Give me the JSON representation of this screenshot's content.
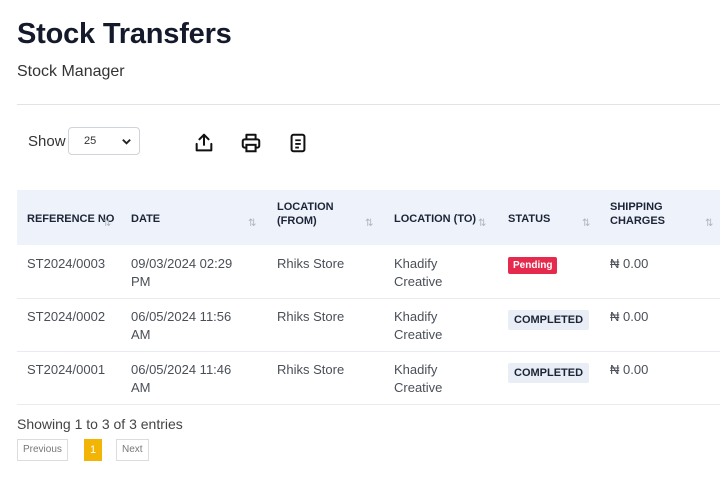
{
  "header": {
    "title": "Stock Transfers",
    "subtitle": "Stock Manager"
  },
  "controls": {
    "show_label": "Show",
    "page_length": "25",
    "icons": [
      "export-icon",
      "print-icon",
      "document-icon"
    ]
  },
  "table": {
    "columns": {
      "reference": "REFERENCE NO",
      "date": "DATE",
      "from_line1": "LOCATION",
      "from_line2": "(FROM)",
      "to": "LOCATION (TO)",
      "status": "STATUS",
      "shipping_line1": "SHIPPING",
      "shipping_line2": "CHARGES"
    },
    "rows": [
      {
        "reference": "ST2024/0003",
        "date_line1": "09/03/2024 02:29",
        "date_line2": "PM",
        "from": "Rhiks Store",
        "to_line1": "Khadify",
        "to_line2": "Creative",
        "status": "Pending",
        "shipping": "₦ 0.00"
      },
      {
        "reference": "ST2024/0002",
        "date_line1": "06/05/2024 11:56",
        "date_line2": "AM",
        "from": "Rhiks Store",
        "to_line1": "Khadify",
        "to_line2": "Creative",
        "status": "COMPLETED",
        "shipping": "₦ 0.00"
      },
      {
        "reference": "ST2024/0001",
        "date_line1": "06/05/2024 11:46",
        "date_line2": "AM",
        "from": "Rhiks Store",
        "to_line1": "Khadify",
        "to_line2": "Creative",
        "status": "COMPLETED",
        "shipping": "₦ 0.00"
      }
    ]
  },
  "footer": {
    "info": "Showing 1 to 3 of 3 entries",
    "previous": "Previous",
    "current_page": "1",
    "next": "Next"
  },
  "colors": {
    "pending": "#e52a4d",
    "completed_bg": "#e9eef6",
    "current_page": "#f2b505",
    "header_bg": "#eef3fb"
  }
}
